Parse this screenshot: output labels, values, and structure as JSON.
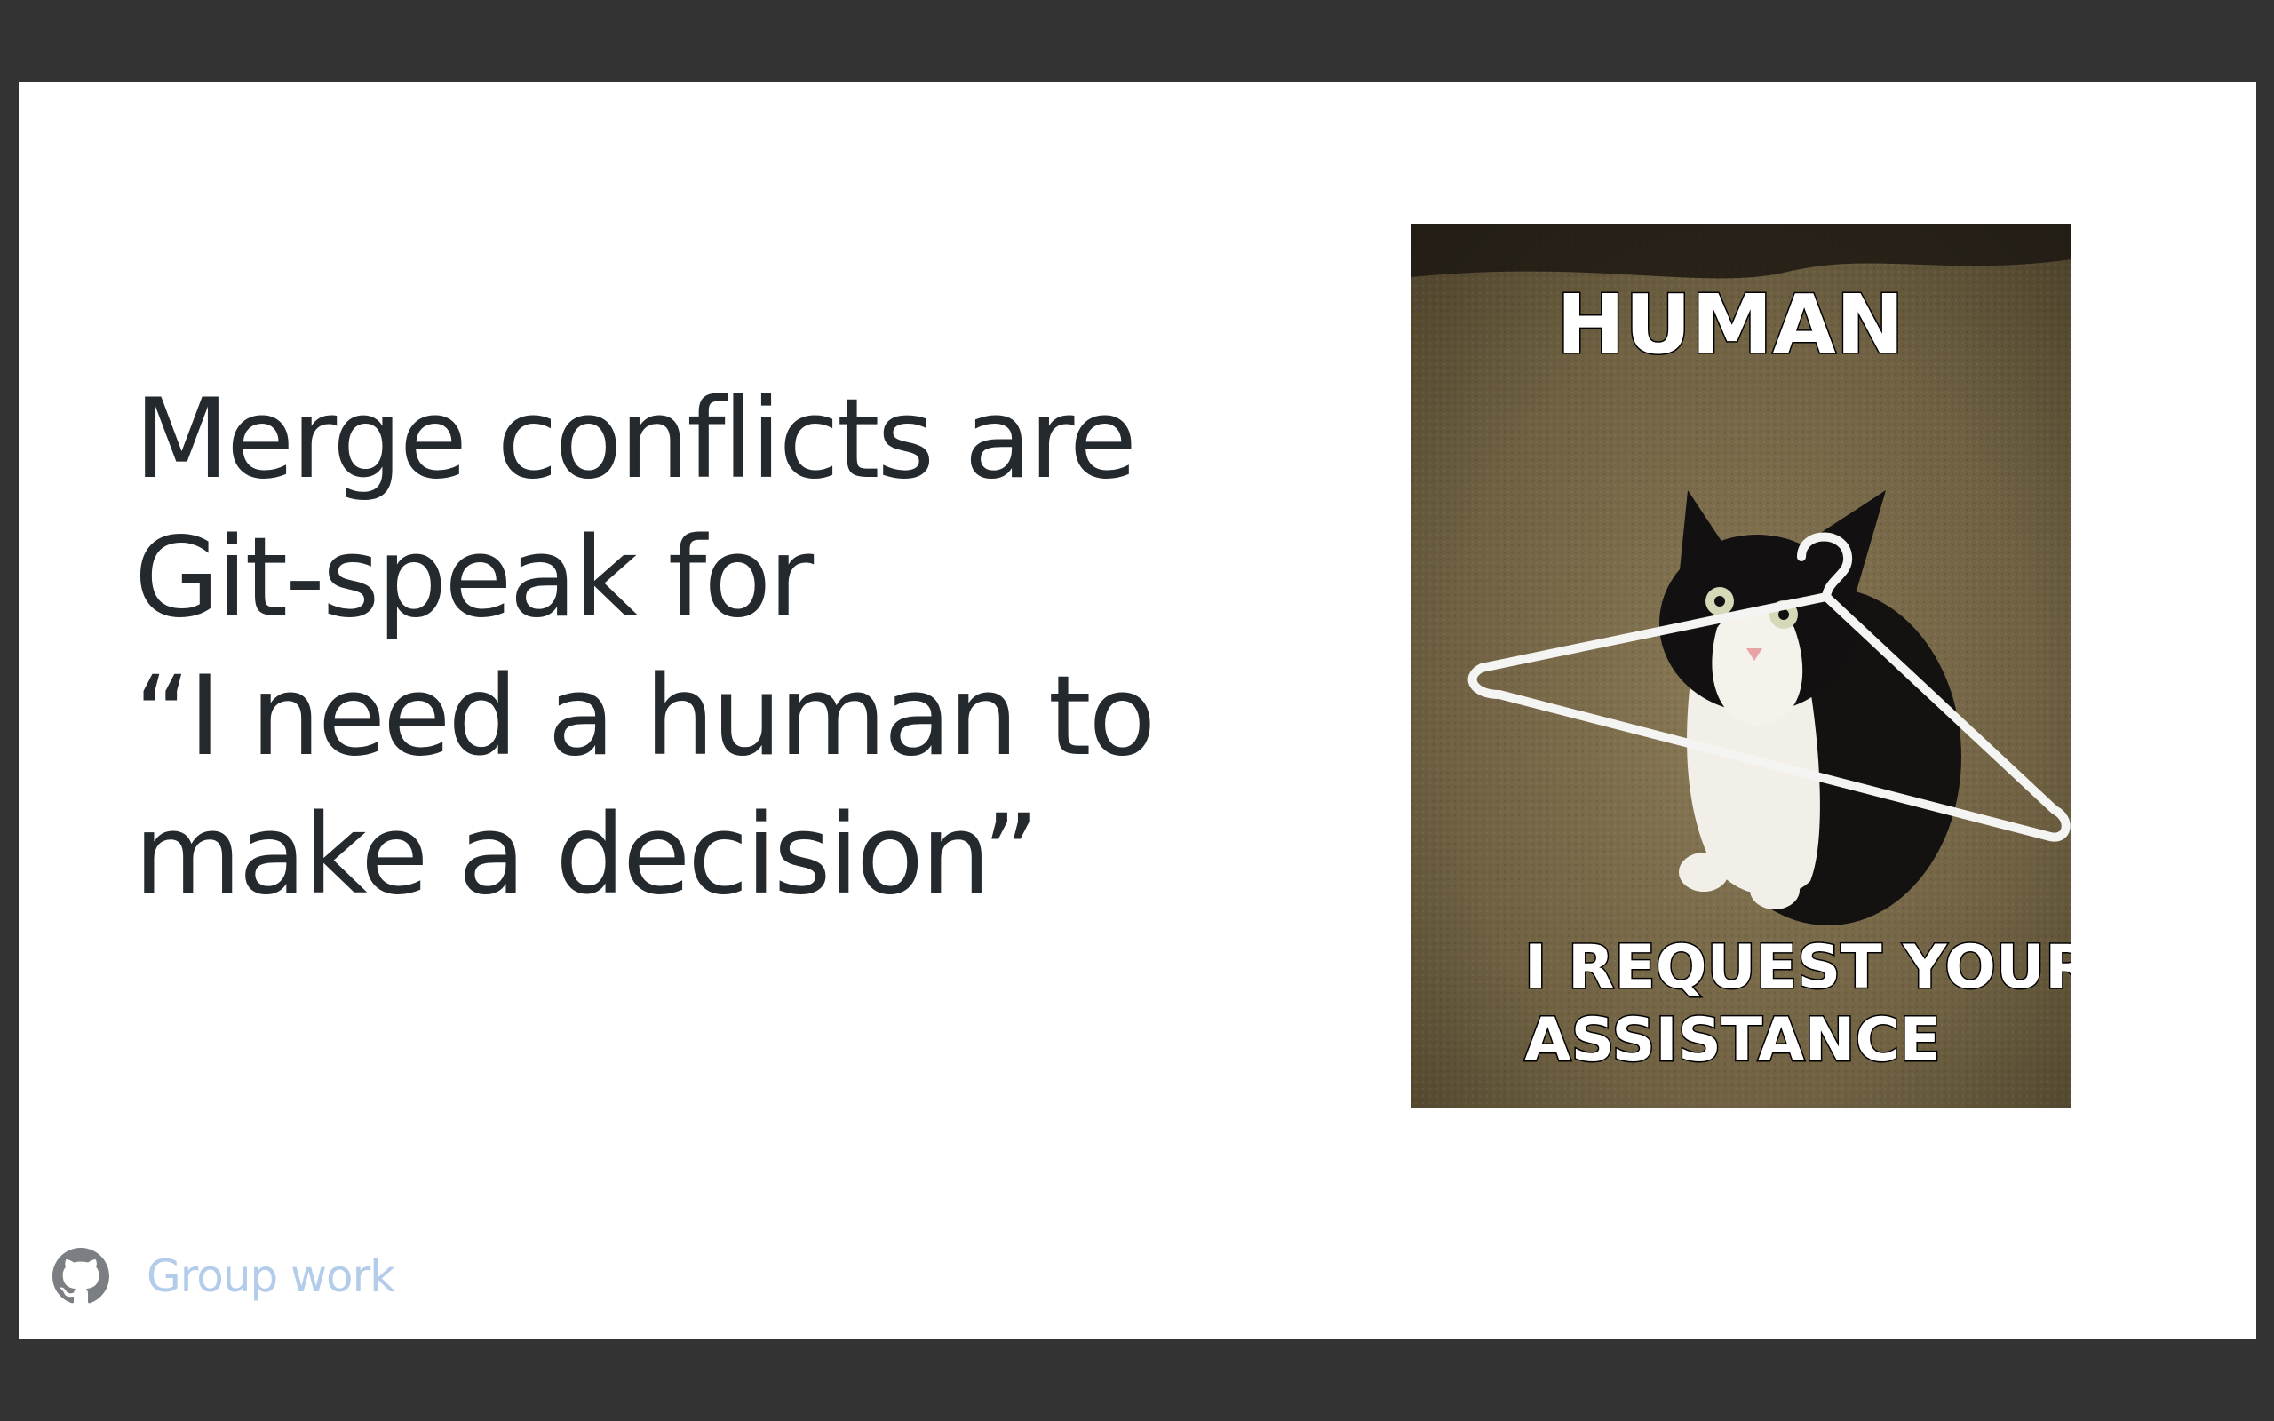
{
  "slide": {
    "headline_lines": [
      "Merge conflicts are",
      "Git-speak for",
      "“I need a human to",
      "make a decision”"
    ],
    "meme": {
      "top_text": "HUMAN",
      "bottom_text_line1": "I REQUEST YOUR",
      "bottom_text_line2": "ASSISTANCE"
    },
    "footer": {
      "icon": "github-icon",
      "label": "Group work"
    }
  },
  "colors": {
    "frame": "#333333",
    "slide_bg": "#ffffff",
    "headline": "#24292e",
    "footer_label": "#b3ccea"
  }
}
